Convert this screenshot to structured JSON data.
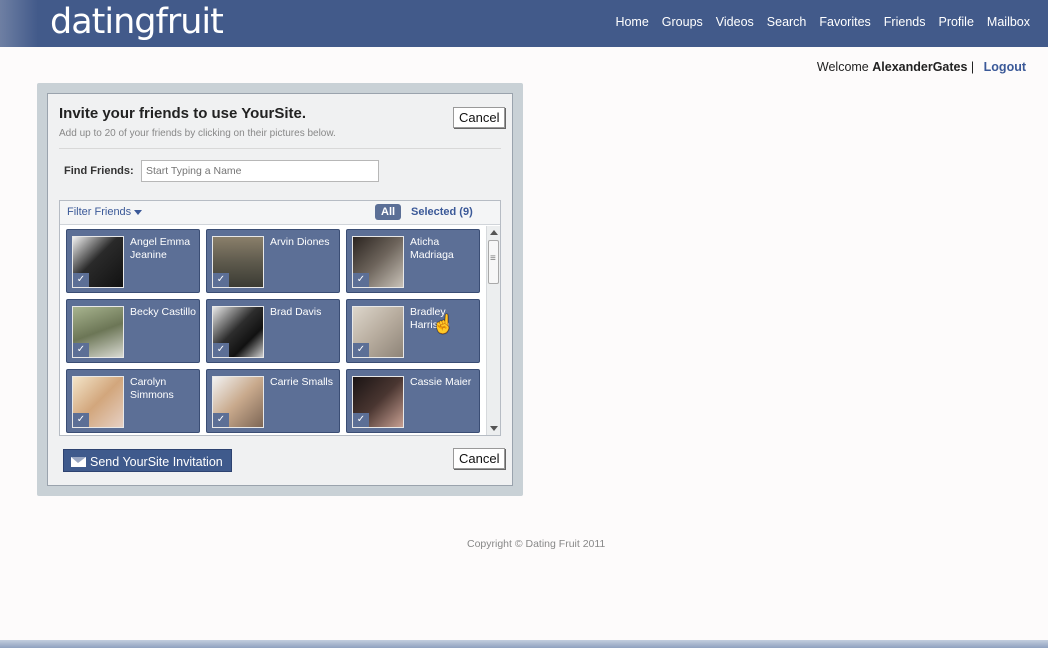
{
  "app": {
    "logo": "datingfruit"
  },
  "nav": {
    "items": [
      "Home",
      "Groups",
      "Videos",
      "Search",
      "Favorites",
      "Friends",
      "Profile",
      "Mailbox"
    ]
  },
  "user": {
    "welcome": "Welcome",
    "name": "AlexanderGates",
    "separator": "|",
    "logout": "Logout"
  },
  "dialog": {
    "title": "Invite your friends to use YourSite.",
    "subtitle": "Add up to 20 of your friends by clicking on their pictures below.",
    "cancel_label": "Cancel",
    "find_label": "Find Friends:",
    "find_placeholder": "Start Typing a Name",
    "filter_label": "Filter Friends",
    "all_label": "All",
    "selected_label": "Selected (9)",
    "send_label": "Send YourSite Invitation",
    "friends": [
      {
        "name": "Angel Emma Jeanine",
        "selected": true,
        "photo_color": "#2a2a2a"
      },
      {
        "name": "Arvin Diones",
        "selected": true,
        "photo_color": "#6b6657"
      },
      {
        "name": "Aticha Madriaga",
        "selected": true,
        "photo_color": "#5a534d"
      },
      {
        "name": "Becky Castillo",
        "selected": true,
        "photo_color": "#7f8a6a"
      },
      {
        "name": "Brad Davis",
        "selected": true,
        "photo_color": "#3a3a3a"
      },
      {
        "name": "Bradley Harrison",
        "selected": true,
        "photo_color": "#c9c0b2"
      },
      {
        "name": "Carolyn Simmons",
        "selected": true,
        "photo_color": "#c9a98a"
      },
      {
        "name": "Carrie Smalls",
        "selected": true,
        "photo_color": "#b79e86"
      },
      {
        "name": "Cassie Maier",
        "selected": true,
        "photo_color": "#3d2e2a"
      }
    ]
  },
  "footer": {
    "copyright": "Copyright © Dating Fruit 2011"
  }
}
